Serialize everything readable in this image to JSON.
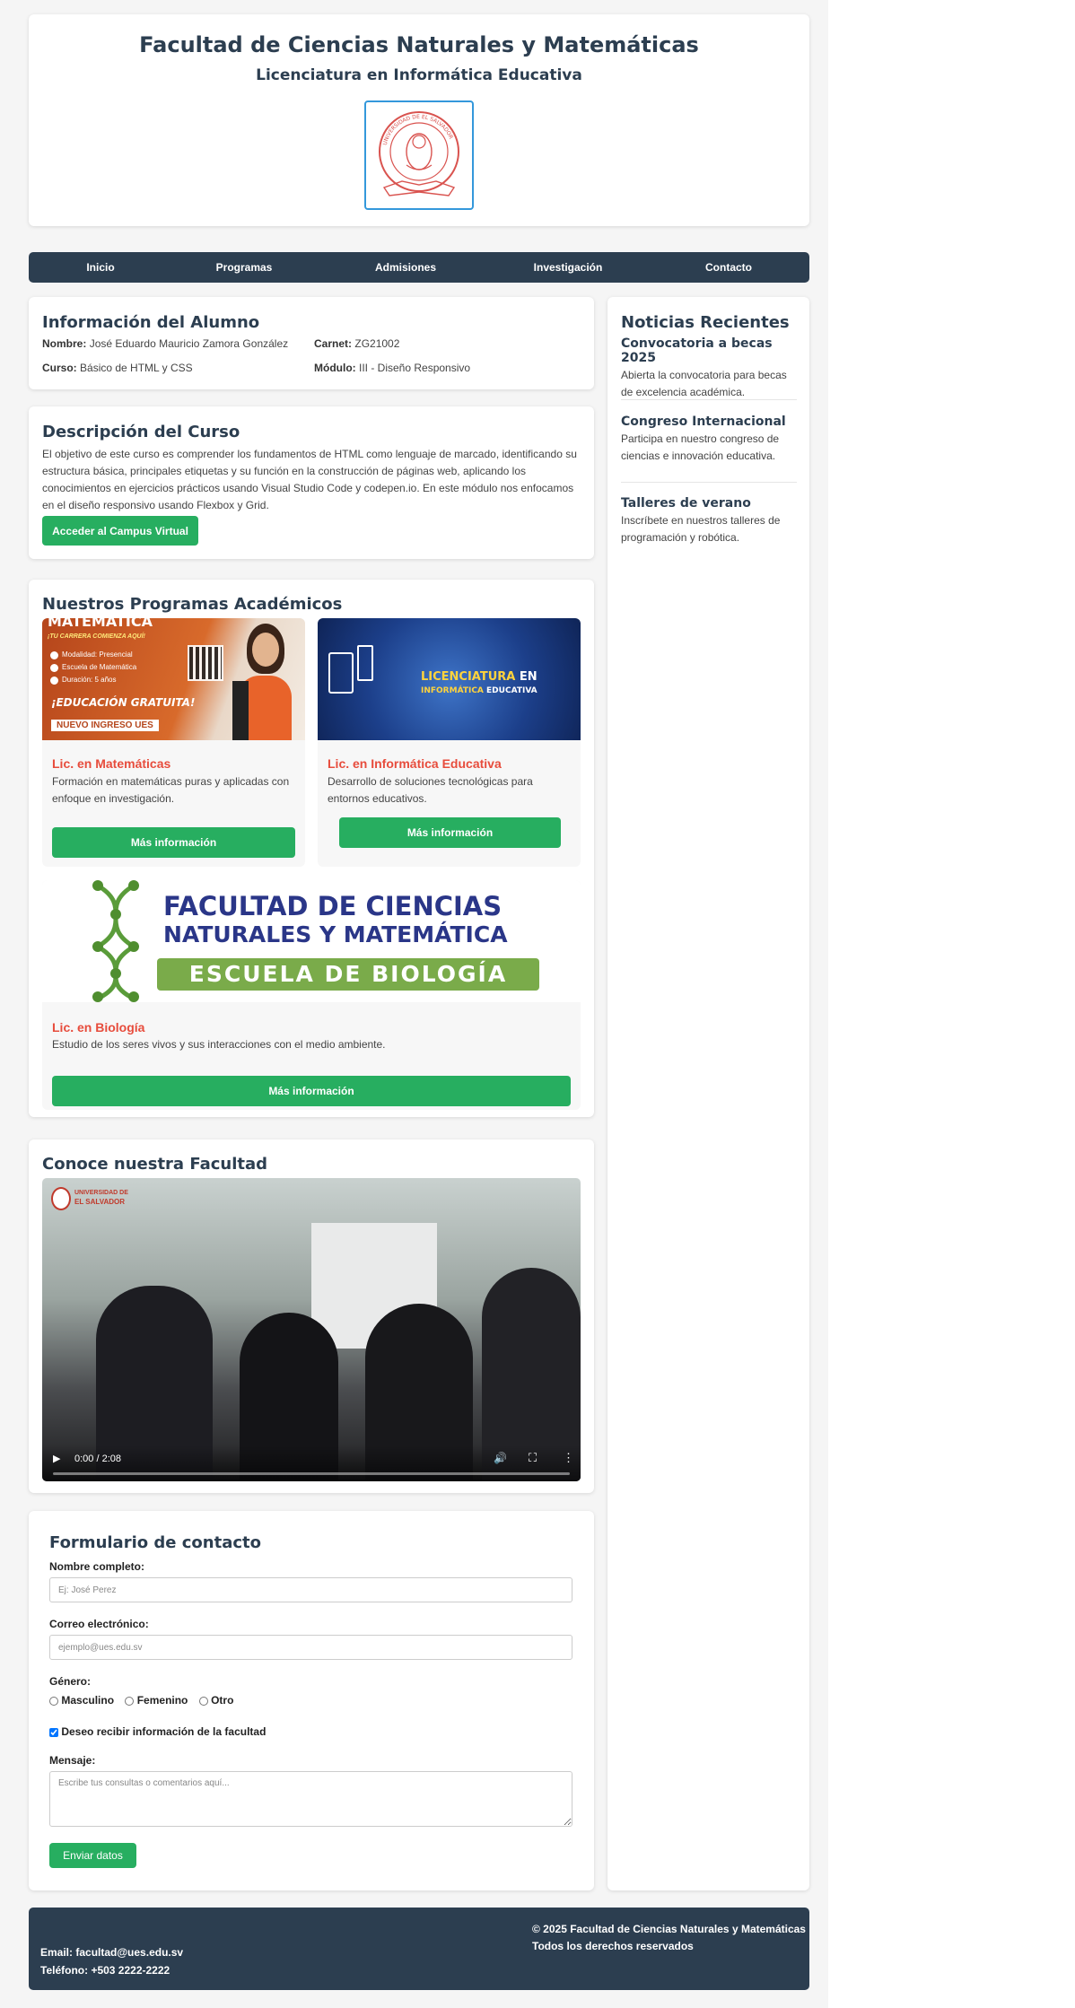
{
  "header": {
    "title": "Facultad de Ciencias Naturales y Matemáticas",
    "subtitle": "Licenciatura en Informática Educativa",
    "seal": {
      "text_top": "UNIVERSIDAD DE EL SALVADOR",
      "text_bottom": "HACIA LA LIBERTAD POR LA CULTURA",
      "ribbon": "TENTAMEN A CULTURA",
      "color": "#d9534f"
    }
  },
  "nav": {
    "items": [
      "Inicio",
      "Programas",
      "Admisiones",
      "Investigación",
      "Contacto"
    ]
  },
  "student": {
    "heading": "Información del Alumno",
    "name_label": "Nombre:",
    "name_value": "José Eduardo Mauricio Zamora González",
    "carnet_label": "Carnet:",
    "carnet_value": "ZG21002",
    "course_label": "Curso:",
    "course_value": "Básico de HTML y CSS",
    "module_label": "Módulo:",
    "module_value": "III - Diseño Responsivo"
  },
  "course": {
    "heading": "Descripción del Curso",
    "text": "El objetivo de este curso es comprender los fundamentos de HTML como lenguaje de marcado, identificando su estructura básica, principales etiquetas y su función en la construcción de páginas web, aplicando los conocimientos en ejercicios prácticos usando Visual Studio Code y codepen.io. En este módulo nos enfocamos en el diseño responsivo usando Flexbox y Grid.",
    "button": "Acceder al Campus Virtual"
  },
  "programs": {
    "heading": "Nuestros Programas Académicos",
    "items": [
      {
        "title": "Lic. en Matemáticas",
        "desc": "Formación en matemáticas puras y aplicadas con enfoque en investigación.",
        "button": "Más información",
        "image": {
          "top": "MATEMÁTICA",
          "tag": "¡TU CARRERA COMIENZA AQUÍ!",
          "bullets": [
            "Modalidad: Presencial",
            "Escuela de Matemática",
            "Duración: 5 años"
          ],
          "banner1": "¡EDUCACIÓN GRATUITA!",
          "banner2": "NUEVO INGRESO UES"
        }
      },
      {
        "title": "Lic. en Informática Educativa",
        "desc": "Desarrollo de soluciones tecnológicas para entornos educativos.",
        "button": "Más información",
        "image": {
          "line1a": "LICENCIATURA",
          "line1b": "EN",
          "line2a": "INFORMÁTICA",
          "line2b": "EDUCATIVA"
        }
      },
      {
        "title": "Lic. en Biología",
        "desc": "Estudio de los seres vivos y sus interacciones con el medio ambiente.",
        "button": "Más información",
        "image": {
          "line1": "FACULTAD DE CIENCIAS",
          "line2": "NATURALES Y MATEMÁTICA",
          "line3": "ESCUELA DE BIOLOGÍA"
        }
      }
    ]
  },
  "video": {
    "heading": "Conoce nuestra Facultad",
    "logo_line1": "UNIVERSIDAD DE",
    "logo_line2": "EL SALVADOR",
    "time": "0:00 / 2:08",
    "progress": 0
  },
  "news": {
    "heading": "Noticias Recientes",
    "items": [
      {
        "title": "Convocatoria a becas 2025",
        "text": "Abierta la convocatoria para becas de excelencia académica."
      },
      {
        "title": "Congreso Internacional",
        "text": "Participa en nuestro congreso de ciencias e innovación educativa."
      },
      {
        "title": "Talleres de verano",
        "text": "Inscríbete en nuestros talleres de programación y robótica."
      }
    ]
  },
  "form": {
    "heading": "Formulario de contacto",
    "name_label": "Nombre completo:",
    "name_placeholder": "Ej: José Perez",
    "email_label": "Correo electrónico:",
    "email_placeholder": "ejemplo@ues.edu.sv",
    "gender_label": "Género:",
    "gender_options": [
      "Masculino",
      "Femenino",
      "Otro"
    ],
    "checkbox_label": "Deseo recibir información de la facultad",
    "checkbox_checked": true,
    "message_label": "Mensaje:",
    "message_placeholder": "Escribe tus consultas o comentarios aquí...",
    "submit": "Enviar datos"
  },
  "footer": {
    "email": "Email: facultad@ues.edu.sv",
    "phone": "Teléfono: +503 2222-2222",
    "copyright": "© 2025 Facultad de Ciencias Naturales y Matemáticas",
    "rights": "Todos los derechos reservados"
  },
  "colors": {
    "primary": "#2c3e50",
    "accent_green": "#27ae60",
    "accent_red": "#e74c3c",
    "seal_border": "#3498db"
  }
}
